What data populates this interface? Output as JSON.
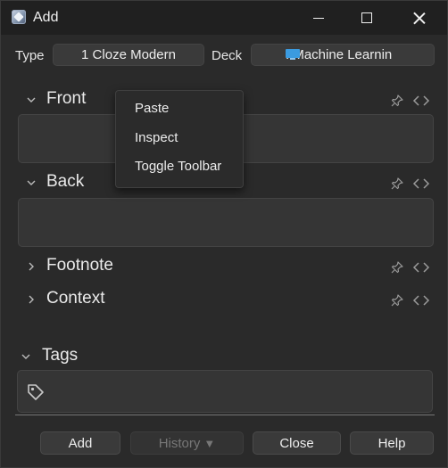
{
  "window": {
    "title": "Add",
    "app_icon": "anki-star-icon"
  },
  "toolbar": {
    "type_label": "Type",
    "notetype_value": "1 Cloze Modern",
    "deck_label": "Deck",
    "deck_value": "::Machine Learnin",
    "deck_icon": "monitor-icon"
  },
  "fields": [
    {
      "name": "Front",
      "expanded": true
    },
    {
      "name": "Back",
      "expanded": true
    },
    {
      "name": "Footnote",
      "expanded": false
    },
    {
      "name": "Context",
      "expanded": false
    }
  ],
  "tags": {
    "label": "Tags",
    "icon": "tag-icon"
  },
  "buttons": {
    "add": "Add",
    "history": "History",
    "history_arrow": "▼",
    "close": "Close",
    "help": "Help"
  },
  "context_menu": {
    "items": [
      "Paste",
      "Inspect",
      "Toggle Toolbar"
    ]
  },
  "colors": {
    "background": "#2a2a2a",
    "titlebar": "#202020",
    "editor": "#353535",
    "deck_icon": "#3b9be0"
  }
}
